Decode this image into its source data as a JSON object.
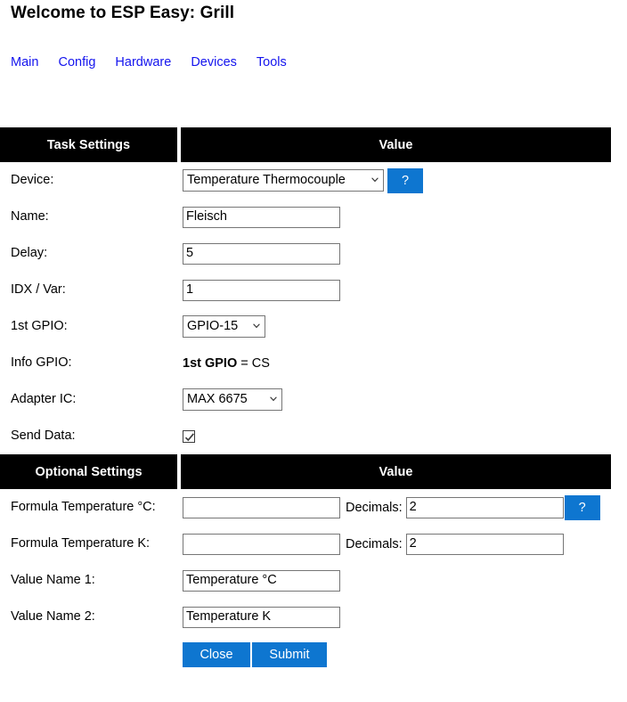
{
  "header": {
    "title": "Welcome to ESP Easy: Grill",
    "nav": [
      {
        "label": "Main"
      },
      {
        "label": "Config"
      },
      {
        "label": "Hardware"
      },
      {
        "label": "Devices"
      },
      {
        "label": "Tools"
      }
    ]
  },
  "colors": {
    "accent_blue": "#0e76d0",
    "link_blue": "#1414ee",
    "header_bar": "#000000",
    "header_text": "#ffffff"
  },
  "task_settings": {
    "col_label": "Task Settings",
    "col_value": "Value",
    "rows": {
      "device": {
        "label": "Device:",
        "value": "Temperature Thermocouple",
        "help_label": "?"
      },
      "name": {
        "label": "Name:",
        "value": "Fleisch",
        "placeholder": ""
      },
      "delay": {
        "label": "Delay:",
        "value": "5",
        "placeholder": ""
      },
      "idx_var": {
        "label": "IDX / Var:",
        "value": "1",
        "placeholder": ""
      },
      "gpio1": {
        "label": "1st GPIO:",
        "value": "GPIO-15"
      },
      "info_gpio": {
        "label": "Info GPIO:",
        "value_bold": "1st GPIO",
        "value_rest": " = CS"
      },
      "adapter_ic": {
        "label": "Adapter IC:",
        "value": "MAX 6675"
      },
      "send_data": {
        "label": "Send Data:",
        "checked": true
      }
    }
  },
  "optional_settings": {
    "col_label": "Optional Settings",
    "col_value": "Value",
    "rows": {
      "formula_c": {
        "label": "Formula Temperature °C:",
        "value": "",
        "placeholder": "",
        "decimals_label": "Decimals:",
        "decimals_value": "2",
        "help_label": "?"
      },
      "formula_k": {
        "label": "Formula Temperature K:",
        "value": "",
        "placeholder": "",
        "decimals_label": "Decimals:",
        "decimals_value": "2"
      },
      "value_name_1": {
        "label": "Value Name 1:",
        "value": "Temperature °C",
        "placeholder": ""
      },
      "value_name_2": {
        "label": "Value Name 2:",
        "value": "Temperature K",
        "placeholder": ""
      }
    }
  },
  "actions": {
    "close_label": "Close",
    "submit_label": "Submit"
  }
}
